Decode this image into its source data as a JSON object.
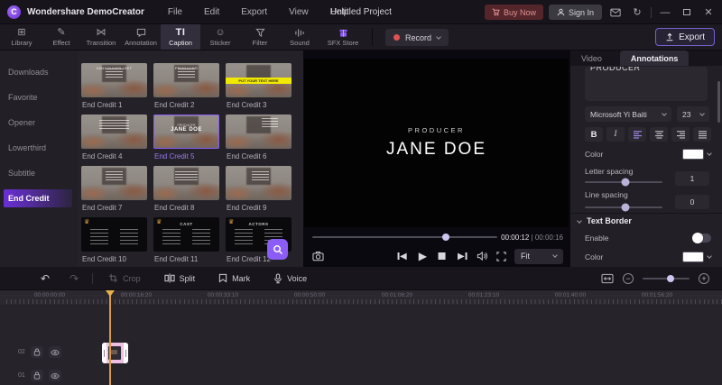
{
  "colors": {
    "accent": "#8b5cf6",
    "record_red": "#e05252",
    "playhead": "#d79b3a",
    "clip_pink": "#ecbfe3",
    "buy_now_bg": "#54262c",
    "text_color_swatch": "#ffffff",
    "banner_yellow": "#f2e900"
  },
  "titlebar": {
    "app_name": "Wondershare DemoCreator",
    "menus": [
      "File",
      "Edit",
      "Export",
      "View",
      "Help"
    ],
    "project_title": "Untitled Project",
    "buy_now_label": "Buy Now",
    "sign_in_label": "Sign In"
  },
  "ribbon": {
    "tabs": [
      "Library",
      "Effect",
      "Transition",
      "Annotation",
      "Caption",
      "Sticker",
      "Filter",
      "Sound",
      "SFX Store"
    ],
    "active_tab": "Caption",
    "caption_icon_text": "TI",
    "record_label": "Record",
    "export_label": "Export"
  },
  "sidebar": {
    "items": [
      "Downloads",
      "Favorite",
      "Opener",
      "Lowerthird",
      "Subtitle",
      "End Credit"
    ],
    "active": "End Credit"
  },
  "library": {
    "cards": [
      {
        "label": "End Credit 1",
        "title": "VANCOUVER UNIT"
      },
      {
        "label": "End Credit 2",
        "title": "PRODUCER"
      },
      {
        "label": "End Credit 3",
        "banner": "PUT YOUR TEXT HERE"
      },
      {
        "label": "End Credit 4"
      },
      {
        "label": "End Credit 5",
        "subtitle": "PRODUCER",
        "title": "JANE DOE",
        "selected": true
      },
      {
        "label": "End Credit 6"
      },
      {
        "label": "End Credit 7"
      },
      {
        "label": "End Credit 8"
      },
      {
        "label": "End Credit 9"
      },
      {
        "label": "End Credit 10"
      },
      {
        "label": "End Credit 11",
        "title": "CAST"
      },
      {
        "label": "End Credit 12",
        "title": "ACTORS"
      }
    ]
  },
  "preview": {
    "subtitle_line": "PRODUCER",
    "name_line": "JANE DOE",
    "current_time": "00:00:12",
    "time_separator": "|",
    "total_time": "00:00:16",
    "fit_label": "Fit",
    "seek_pct": 72
  },
  "inspector": {
    "tabs": [
      "Video",
      "Annotations"
    ],
    "active_tab": "Annotations",
    "text_value": "PRODUCER",
    "font_family": "Microsoft Yi Baiti",
    "font_size": "23",
    "bold_label": "B",
    "italic_label": "I",
    "color_label": "Color",
    "letter_spacing_label": "Letter spacing",
    "letter_spacing_value": "1",
    "letter_spacing_pct": 52,
    "line_spacing_label": "Line spacing",
    "line_spacing_value": "0",
    "line_spacing_pct": 52,
    "text_border": {
      "header": "Text Border",
      "enable_label": "Enable",
      "color_label": "Color"
    }
  },
  "timeline": {
    "tools": {
      "crop": "Crop",
      "split": "Split",
      "mark": "Mark",
      "voice": "Voice"
    },
    "zoom_pct": 60,
    "ruler_labels": [
      "00:00:00:00",
      "00:00:16:20",
      "00:00:33:10",
      "00:00:50:00",
      "00:01:06:20",
      "00:01:23:10",
      "00:01:40:00",
      "00:01:56:20"
    ],
    "tracks": [
      {
        "id": "02"
      },
      {
        "id": "01"
      }
    ]
  }
}
